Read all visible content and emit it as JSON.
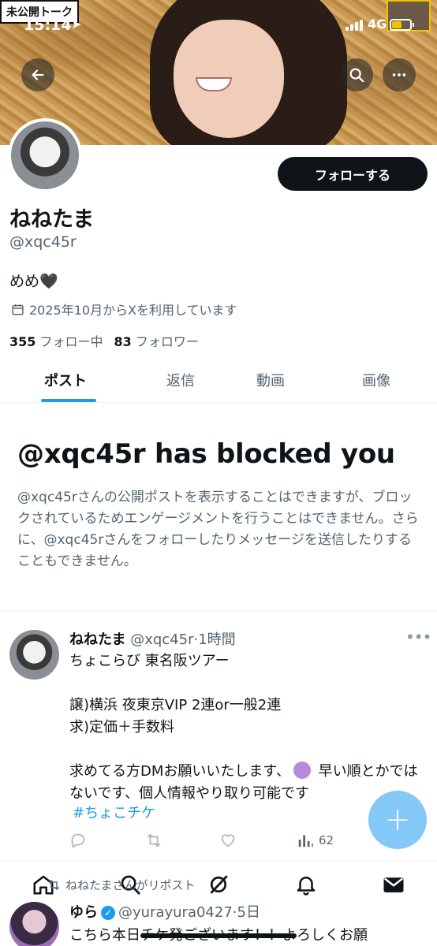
{
  "status_bar": {
    "time": "15:14",
    "network": "4G"
  },
  "banner": {
    "tag_text": "未公開トーク"
  },
  "profile": {
    "display_name": "ねねたま",
    "handle": "@xqc45r",
    "bio": "めめ🖤",
    "joined": "2025年10月からXを利用しています",
    "following_count": "355",
    "following_label": "フォロー中",
    "followers_count": "83",
    "followers_label": "フォロワー",
    "follow_button": "フォローする"
  },
  "tabs": [
    {
      "label": "ポスト",
      "active": true
    },
    {
      "label": "返信",
      "active": false
    },
    {
      "label": "動画",
      "active": false
    },
    {
      "label": "画像",
      "active": false
    }
  ],
  "blocked": {
    "title": "@xqc45r has blocked you",
    "description": "@xqc45rさんの公開ポストを表示することはできますが、ブロックされているためエンゲージメントを行うことはできません。さらに、@xqc45rさんをフォローしたりメッセージを送信したりすることもできません。"
  },
  "tweet": {
    "author": "ねねたま",
    "handle": "@xqc45r",
    "time": "·1時間",
    "lines": [
      "ちょこらび 東名阪ツアー",
      "",
      "譲)横浜 夜東京VIP 2連or一般2連",
      "求)定価＋手数料",
      "",
      "求めてる方DMお願いいたします、"
    ],
    "line_after_emoji": " 早い順とかではないです、個人情報やり取り可能です",
    "hashtag": "#ちょこチケ",
    "views": "62"
  },
  "repost_row": {
    "text": "ねねたまさんがリポスト"
  },
  "tweet2": {
    "author": "ゆら",
    "handle": "@yurayura0427",
    "time": "·5日",
    "text": "こちら本日チケ発ございます！！よろしくお願"
  },
  "fab": {
    "label": "+"
  },
  "colors": {
    "accent": "#1d9bf0",
    "text_primary": "#0f1419",
    "text_secondary": "#536471"
  },
  "icons": {
    "back": "arrow-left-icon",
    "search": "search-icon",
    "more": "more-horizontal-icon",
    "calendar": "calendar-icon",
    "reply": "reply-icon",
    "repost": "repost-icon",
    "like": "heart-icon",
    "views": "bar-chart-icon",
    "home": "home-icon",
    "explore": "search-icon",
    "grok": "grok-icon",
    "notifications": "bell-icon",
    "messages": "envelope-icon"
  }
}
